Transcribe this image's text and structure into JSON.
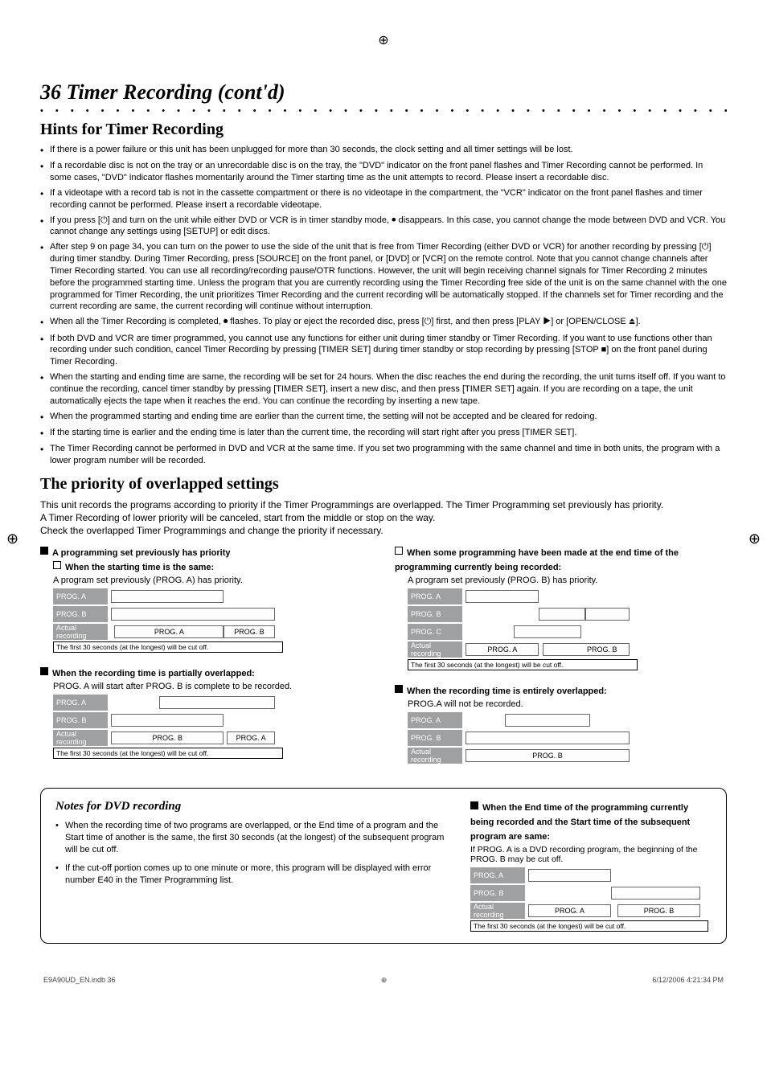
{
  "page_number_title": "36  Timer Recording (cont'd)",
  "section_hints": "Hints for Timer Recording",
  "section_priority": "The priority of overlapped settings",
  "hints": [
    "If there is a power failure or this unit has been unplugged for more than 30 seconds, the clock setting and all timer settings will be lost.",
    "If a recordable disc is not on the tray or an unrecordable disc is on the tray, the \"DVD\" indicator on the front panel flashes and Timer Recording cannot be performed. In some cases, \"DVD\" indicator flashes momentarily around the Timer starting time as the unit attempts to record. Please insert a recordable disc.",
    "If a videotape with a record tab is not in the cassette compartment or there is no videotape in the compartment, the \"VCR\" indicator on the front panel flashes and timer recording cannot be performed. Please insert a recordable videotape.",
    "If you press [⏻] and turn on the unit while either DVD or VCR is in timer standby mode, ⏺ disappears. In this case, you cannot change the mode between DVD and VCR. You cannot change any settings using [SETUP] or edit discs.",
    "After step 9 on page 34, you can turn on the power to use the side of the unit that is free from Timer Recording (either DVD or VCR) for another recording by pressing [⏻] during timer standby. During Timer Recording, press [SOURCE] on the front panel, or [DVD] or [VCR] on the remote control. Note that you cannot change channels after Timer Recording started. You can use all recording/recording pause/OTR functions. However, the unit will begin receiving channel signals for Timer Recording 2 minutes before the programmed starting time. Unless the program that you are currently recording using the Timer Recording free side of the unit is on the same channel with the one programmed for Timer Recording, the unit prioritizes Timer Recording and the current recording will be automatically stopped. If the channels set for Timer recording and the current recording are same, the current recording will continue without interruption.",
    "When all the Timer Recording is completed, ⏺ flashes. To play or eject the recorded disc, press [⏻] first, and then press [PLAY ▶] or [OPEN/CLOSE ⏏].",
    "If both DVD and VCR are timer programmed, you cannot use any functions for either unit during timer standby or Timer Recording. If you want to use functions other than recording under such condition, cancel Timer Recording by pressing [TIMER SET] during timer standby or stop recording by pressing [STOP ■] on the front panel during Timer Recording.",
    "When the starting and ending time are same, the recording will be set for 24 hours. When the disc reaches the end during the recording, the unit turns itself off. If you want to continue the recording, cancel timer standby by pressing [TIMER SET], insert a new disc, and then press [TIMER SET] again. If you are recording on a tape, the unit automatically ejects the tape when it reaches the end. You can continue the recording by inserting a new tape.",
    "When the programmed starting and ending time are earlier than the current time, the setting will not be accepted and be cleared for redoing.",
    "If the starting time is earlier and the ending time is later than the current time, the recording will start right after you press [TIMER SET].",
    "The Timer Recording cannot be performed in DVD and VCR at the same time. If you set two programming with the same channel and time in both units, the program with a lower program number will be recorded."
  ],
  "priority_intro": [
    "This unit records the programs according to priority if the Timer Programmings are overlapped. The Timer Programming set previously has priority.",
    "A Timer Recording of lower priority will be canceled, start from the middle or stop on the way.",
    "Check the overlapped Timer Programmings and change the priority if necessary."
  ],
  "cases": {
    "prev": {
      "title": "A programming set previously has priority",
      "sub_title": "When the starting time is the same:",
      "sub_body": "A program set previously (PROG. A) has priority.",
      "rows": [
        "PROG. A",
        "PROG. B",
        "Actual recording"
      ],
      "actual": [
        "PROG. A",
        "PROG. B"
      ],
      "cutoff": "The first 30 seconds (at the longest) will be cut off."
    },
    "partial": {
      "title": "When the recording time is partially overlapped:",
      "sub_body": "PROG. A will start after PROG. B is complete to be recorded.",
      "rows": [
        "PROG. A",
        "PROG. B",
        "Actual recording"
      ],
      "actual": [
        "PROG. B",
        "PROG. A"
      ],
      "cutoff": "The first 30 seconds (at the longest) will be cut off."
    },
    "made_end": {
      "title": "When some programming have been made at the end time of the programming currently being recorded:",
      "sub_body": "A program set previously (PROG. B) has priority.",
      "rows": [
        "PROG. A",
        "PROG. B",
        "PROG. C",
        "Actual recording"
      ],
      "actual": [
        "PROG. A",
        "PROG. B"
      ],
      "cutoff": "The first 30 seconds (at the longest) will be cut off."
    },
    "entire": {
      "title": "When the recording time is entirely overlapped:",
      "sub_body": "PROG.A will not be recorded.",
      "rows": [
        "PROG. A",
        "PROG. B",
        "Actual recording"
      ],
      "actual": [
        "PROG. B"
      ]
    }
  },
  "notes": {
    "title": "Notes for DVD recording",
    "items": [
      "When the recording time of two programs are overlapped, or the End time of a program and the Start time of another is the same, the first 30 seconds (at the longest) of the subsequent program will be cut off.",
      "If the cut-off portion comes up to one minute or more, this program will be displayed with error number E40 in the Timer Programming list."
    ],
    "right": {
      "title": "When the End time of the programming currently being recorded and the Start time of the subsequent program are same:",
      "sub_body": "If PROG. A is a DVD recording program, the beginning of the PROG. B may be cut off.",
      "rows": [
        "PROG. A",
        "PROG. B",
        "Actual recording"
      ],
      "actual": [
        "PROG. A",
        "PROG. B"
      ],
      "cutoff": "The first 30 seconds (at the longest) will be cut off."
    }
  },
  "footer": {
    "left": "E9A90UD_EN.indb   36",
    "right": "6/12/2006   4:21:34 PM"
  },
  "reg_mark": "⊕"
}
